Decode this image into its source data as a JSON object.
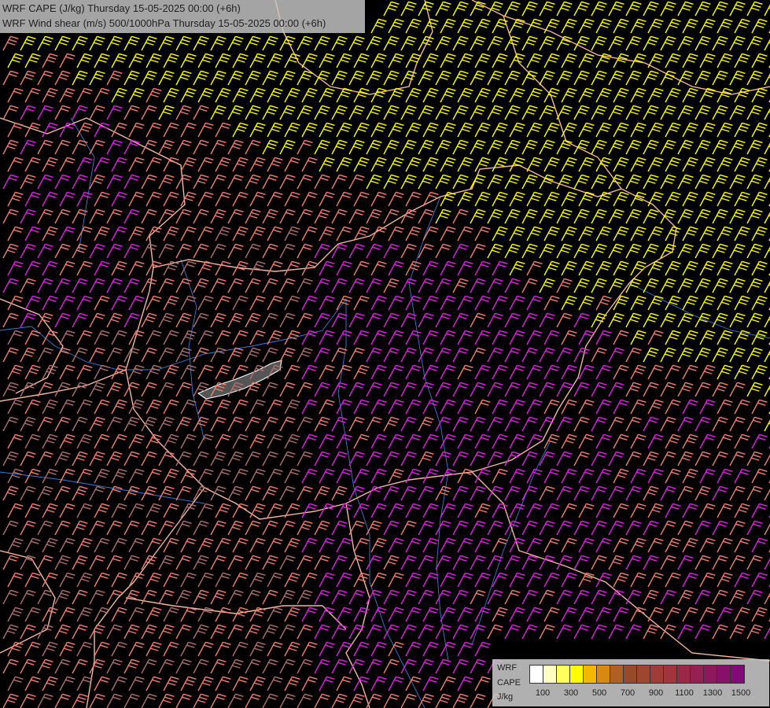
{
  "title_lines": [
    "WRF CAPE (J/kg) Thursday 15-05-2025 00:00 (+6h)",
    "WRF Wind shear (m/s) 500/1000hPa Thursday 15-05-2025 00:00 (+6h)"
  ],
  "legend": {
    "line1": "WRF",
    "line2": "CAPE",
    "unit": "J/kg",
    "tick_labels": [
      "100",
      "300",
      "500",
      "700",
      "900",
      "1100",
      "1300",
      "1500"
    ],
    "colors": [
      "#ffffff",
      "#ffffc0",
      "#ffff60",
      "#ffff00",
      "#f5b800",
      "#d88a10",
      "#b06020",
      "#964a2a",
      "#9e4632",
      "#a03c38",
      "#a2343e",
      "#9c2848",
      "#962052",
      "#8e185c",
      "#86106a",
      "#800a76"
    ]
  },
  "barb_colors": {
    "yellow": "#ffff00",
    "salmon": "#f08070",
    "magenta": "#e020e0",
    "brown": "#b07070"
  },
  "background": "#000000",
  "border_color": "#f4b8a0",
  "river_color": "#3a7bd5"
}
